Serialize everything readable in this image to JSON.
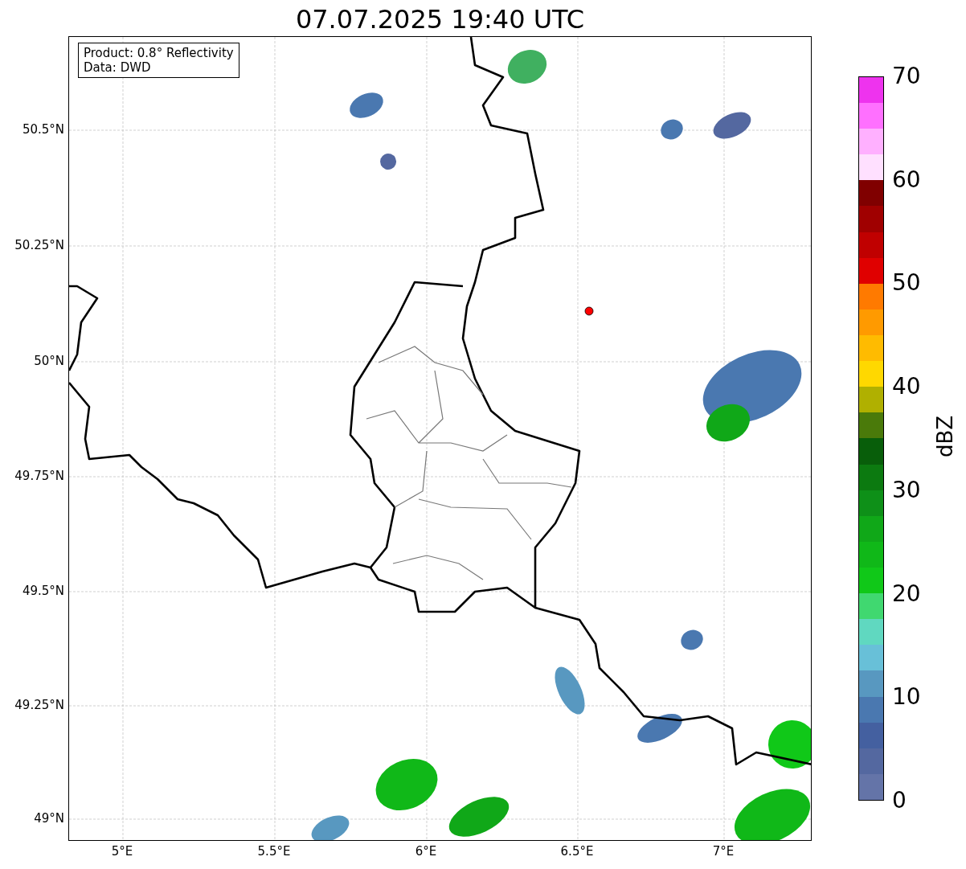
{
  "title": "07.07.2025 19:40 UTC",
  "info_box": [
    "Product: 0.8° Reflectivity",
    "Data: DWD"
  ],
  "map": {
    "y_ticks": [
      "50.5°N",
      "50.25°N",
      "50°N",
      "49.75°N",
      "49.5°N",
      "49.25°N",
      "49°N"
    ],
    "x_ticks": [
      "5°E",
      "5.5°E",
      "6°E",
      "6.5°E",
      "7°E"
    ]
  },
  "colorbar": {
    "label": "dBZ",
    "ticks": [
      "70",
      "60",
      "50",
      "40",
      "30",
      "20",
      "10",
      "0"
    ],
    "bands": [
      {
        "color": "#6474a8"
      },
      {
        "color": "#5468a0"
      },
      {
        "color": "#4460a0"
      },
      {
        "color": "#4a78b0"
      },
      {
        "color": "#5898c0"
      },
      {
        "color": "#68c0d8"
      },
      {
        "color": "#60d8c0"
      },
      {
        "color": "#40d870"
      },
      {
        "color": "#10c818"
      },
      {
        "color": "#10b818"
      },
      {
        "color": "#10a818"
      },
      {
        "color": "#0e9018"
      },
      {
        "color": "#0c7a10"
      },
      {
        "color": "#085e0a"
      },
      {
        "color": "#4a7a0a"
      },
      {
        "color": "#b0b000"
      },
      {
        "color": "#ffd800"
      },
      {
        "color": "#ffbb00"
      },
      {
        "color": "#ff9a00"
      },
      {
        "color": "#ff7a00"
      },
      {
        "color": "#e00000"
      },
      {
        "color": "#c00000"
      },
      {
        "color": "#a00000"
      },
      {
        "color": "#800000"
      },
      {
        "color": "#ffe0ff"
      },
      {
        "color": "#ffb0ff"
      },
      {
        "color": "#ff70ff"
      },
      {
        "color": "#ee33ee"
      }
    ]
  }
}
